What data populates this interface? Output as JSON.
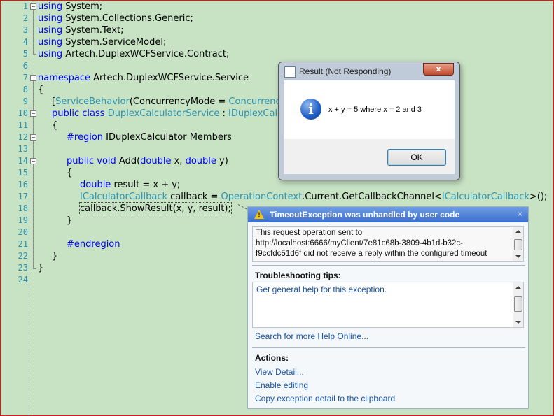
{
  "editor": {
    "line_numbers": [
      "1",
      "2",
      "3",
      "4",
      "5",
      "6",
      "7",
      "8",
      "9",
      "10",
      "11",
      "12",
      "13",
      "14",
      "15",
      "16",
      "17",
      "18",
      "19",
      "20",
      "21",
      "22",
      "23",
      "24"
    ],
    "lines": {
      "l1": {
        "kw": "using",
        "rest": " System;"
      },
      "l2": {
        "kw": "using",
        "rest": " System.Collections.Generic;"
      },
      "l3": {
        "kw": "using",
        "rest": " System.Text;"
      },
      "l4": {
        "kw": "using",
        "rest": " System.ServiceModel;"
      },
      "l5": {
        "kw": "using",
        "rest": " Artech.DuplexWCFService.Contract;"
      },
      "l7": {
        "kw": "namespace",
        "rest": " Artech.DuplexWCFService.Service"
      },
      "l8": {
        "text": "{"
      },
      "l9": {
        "open": "[",
        "type": "ServiceBehavior",
        "mid": "(ConcurrencyMode = ",
        "type2": "Concurrenc"
      },
      "l10": {
        "kw1": "public",
        "kw2": "class",
        "type": "DuplexCalculatorService",
        "mid": " : ",
        "type2": "IDuplexCal"
      },
      "l11": {
        "text": "{"
      },
      "l12": {
        "kw": "#region",
        "rest": " IDuplexCalculator Members"
      },
      "l14": {
        "kw1": "public",
        "kw2": "void",
        "mid": " Add(",
        "kw3": "double",
        "mid2": " x, ",
        "kw4": "double",
        "end": " y)"
      },
      "l15": {
        "text": "{"
      },
      "l16": {
        "kw": "double",
        "rest": " result = x + y;"
      },
      "l17": {
        "type": "ICalculatorCallback",
        "mid": " callback = ",
        "type2": "OperationContext",
        "mid2": ".Current.GetCallbackChannel<",
        "type3": "ICalculatorCallback",
        "end": ">();"
      },
      "l18": {
        "text": "callback.ShowResult(x, y, result);"
      },
      "l19": {
        "text": "}"
      },
      "l21": {
        "kw": "#endregion"
      },
      "l22": {
        "text": "}"
      },
      "l23": {
        "text": "}"
      }
    }
  },
  "message_box": {
    "title": "Result (Not Responding)",
    "close_glyph": "x",
    "icon": "information-icon",
    "icon_glyph": "i",
    "message": "x + y = 5 where x = 2 and 3",
    "ok_label": "OK"
  },
  "exception_assistant": {
    "title": "TimeoutException was unhandled by user code",
    "close_glyph": "×",
    "warning_glyph": "!",
    "message_lines": [
      "This request operation sent to",
      "http://localhost:6666/myClient/7e81c68b-3809-4b1d-b32c-",
      "f9ccfdc51d6f did not receive a reply within the configured timeout"
    ],
    "tips_label": "Troubleshooting tips:",
    "tip_link": "Get general help for this exception.",
    "search_link": "Search for more Help Online...",
    "actions_label": "Actions:",
    "actions": [
      "View Detail...",
      "Enable editing",
      "Copy exception detail to the clipboard"
    ]
  },
  "colors": {
    "background": "#c7e3c4",
    "keyword": "#0000ff",
    "type": "#2b91af",
    "frame": "#e11111",
    "link": "#1a55a6"
  }
}
